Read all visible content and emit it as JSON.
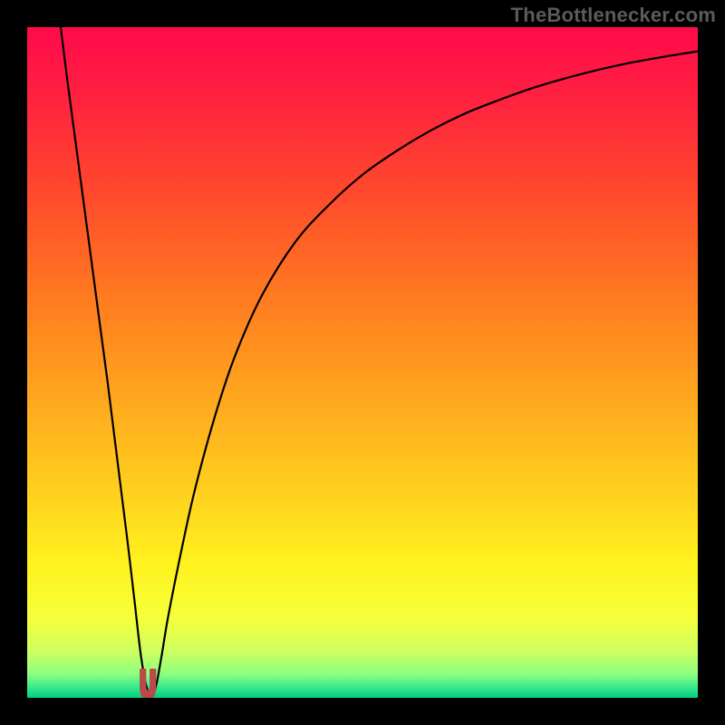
{
  "watermark": "TheBottlenecker.com",
  "colors": {
    "frame": "#000000",
    "curve": "#000000",
    "marker": "#b94a4a",
    "gradient_stops": [
      {
        "offset": 0.0,
        "color": "#ff0a4b"
      },
      {
        "offset": 0.1,
        "color": "#ff2040"
      },
      {
        "offset": 0.25,
        "color": "#ff4a2c"
      },
      {
        "offset": 0.4,
        "color": "#ff7a20"
      },
      {
        "offset": 0.55,
        "color": "#ffa61e"
      },
      {
        "offset": 0.7,
        "color": "#ffd21e"
      },
      {
        "offset": 0.8,
        "color": "#fff21e"
      },
      {
        "offset": 0.88,
        "color": "#f6ff3a"
      },
      {
        "offset": 0.93,
        "color": "#cfff60"
      },
      {
        "offset": 0.965,
        "color": "#8dff80"
      },
      {
        "offset": 0.985,
        "color": "#35e88a"
      },
      {
        "offset": 1.0,
        "color": "#00d184"
      }
    ]
  },
  "chart_data": {
    "type": "line",
    "title": "",
    "xlabel": "",
    "ylabel": "",
    "xlim": [
      0,
      100
    ],
    "ylim": [
      0,
      100
    ],
    "minimum_x": 18,
    "series": [
      {
        "name": "bottleneck-curve",
        "x": [
          5,
          6,
          7,
          8,
          9,
          10,
          11,
          12,
          13,
          14,
          15,
          16,
          17,
          18,
          19,
          20,
          21,
          23,
          25,
          28,
          31,
          35,
          40,
          45,
          50,
          55,
          60,
          65,
          70,
          75,
          80,
          85,
          90,
          95,
          100
        ],
        "y": [
          100,
          92,
          84.5,
          77,
          69.5,
          62,
          54.5,
          47,
          39,
          31,
          23,
          14.5,
          6,
          1,
          1,
          6,
          12,
          22,
          31,
          42,
          51,
          60,
          68,
          73.5,
          78,
          81.5,
          84.5,
          87,
          89,
          90.8,
          92.3,
          93.6,
          94.7,
          95.6,
          96.4
        ]
      }
    ],
    "marker": {
      "x": 18,
      "y": 1,
      "width_x": 2.2,
      "height_y": 3.2
    }
  }
}
